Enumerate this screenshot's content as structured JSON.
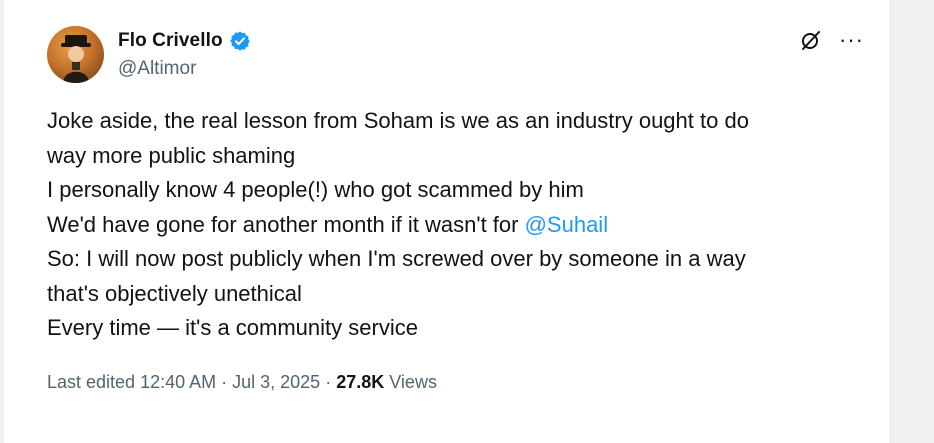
{
  "tweet": {
    "author_name": "Flo Crivello",
    "handle": "@Altimor",
    "lines": [
      {
        "text": "Joke aside, the real lesson from Soham is we as an industry ought to do"
      },
      {
        "text": "way more public shaming"
      },
      {
        "text": "I personally know 4 people(!) who got scammed by him"
      },
      {
        "text": "We'd have gone for another month if it wasn't for ",
        "mention": "@Suhail"
      },
      {
        "text": "So: I will now post publicly when I'm screwed over by someone in a way"
      },
      {
        "text": "that's objectively unethical"
      },
      {
        "text": "Every time — it's a community service"
      }
    ],
    "meta": {
      "edited": "Last edited 12:40 AM",
      "separator": " · ",
      "date": "Jul 3, 2025",
      "views_count": "27.8K",
      "views_label": " Views"
    }
  },
  "icons": {
    "verified": "verified-badge-icon",
    "grok": "grok-icon",
    "more": "more-icon"
  },
  "colors": {
    "text": "#0f1419",
    "secondary": "#536471",
    "accent": "#1d9bf0"
  }
}
